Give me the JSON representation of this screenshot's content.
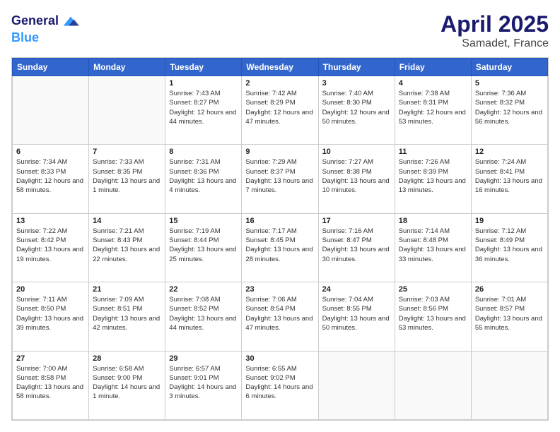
{
  "header": {
    "logo_line1": "General",
    "logo_line2": "Blue",
    "month": "April 2025",
    "location": "Samadet, France"
  },
  "days_of_week": [
    "Sunday",
    "Monday",
    "Tuesday",
    "Wednesday",
    "Thursday",
    "Friday",
    "Saturday"
  ],
  "weeks": [
    [
      {
        "day": "",
        "sunrise": "",
        "sunset": "",
        "daylight": ""
      },
      {
        "day": "",
        "sunrise": "",
        "sunset": "",
        "daylight": ""
      },
      {
        "day": "1",
        "sunrise": "Sunrise: 7:43 AM",
        "sunset": "Sunset: 8:27 PM",
        "daylight": "Daylight: 12 hours and 44 minutes."
      },
      {
        "day": "2",
        "sunrise": "Sunrise: 7:42 AM",
        "sunset": "Sunset: 8:29 PM",
        "daylight": "Daylight: 12 hours and 47 minutes."
      },
      {
        "day": "3",
        "sunrise": "Sunrise: 7:40 AM",
        "sunset": "Sunset: 8:30 PM",
        "daylight": "Daylight: 12 hours and 50 minutes."
      },
      {
        "day": "4",
        "sunrise": "Sunrise: 7:38 AM",
        "sunset": "Sunset: 8:31 PM",
        "daylight": "Daylight: 12 hours and 53 minutes."
      },
      {
        "day": "5",
        "sunrise": "Sunrise: 7:36 AM",
        "sunset": "Sunset: 8:32 PM",
        "daylight": "Daylight: 12 hours and 56 minutes."
      }
    ],
    [
      {
        "day": "6",
        "sunrise": "Sunrise: 7:34 AM",
        "sunset": "Sunset: 8:33 PM",
        "daylight": "Daylight: 12 hours and 58 minutes."
      },
      {
        "day": "7",
        "sunrise": "Sunrise: 7:33 AM",
        "sunset": "Sunset: 8:35 PM",
        "daylight": "Daylight: 13 hours and 1 minute."
      },
      {
        "day": "8",
        "sunrise": "Sunrise: 7:31 AM",
        "sunset": "Sunset: 8:36 PM",
        "daylight": "Daylight: 13 hours and 4 minutes."
      },
      {
        "day": "9",
        "sunrise": "Sunrise: 7:29 AM",
        "sunset": "Sunset: 8:37 PM",
        "daylight": "Daylight: 13 hours and 7 minutes."
      },
      {
        "day": "10",
        "sunrise": "Sunrise: 7:27 AM",
        "sunset": "Sunset: 8:38 PM",
        "daylight": "Daylight: 13 hours and 10 minutes."
      },
      {
        "day": "11",
        "sunrise": "Sunrise: 7:26 AM",
        "sunset": "Sunset: 8:39 PM",
        "daylight": "Daylight: 13 hours and 13 minutes."
      },
      {
        "day": "12",
        "sunrise": "Sunrise: 7:24 AM",
        "sunset": "Sunset: 8:41 PM",
        "daylight": "Daylight: 13 hours and 16 minutes."
      }
    ],
    [
      {
        "day": "13",
        "sunrise": "Sunrise: 7:22 AM",
        "sunset": "Sunset: 8:42 PM",
        "daylight": "Daylight: 13 hours and 19 minutes."
      },
      {
        "day": "14",
        "sunrise": "Sunrise: 7:21 AM",
        "sunset": "Sunset: 8:43 PM",
        "daylight": "Daylight: 13 hours and 22 minutes."
      },
      {
        "day": "15",
        "sunrise": "Sunrise: 7:19 AM",
        "sunset": "Sunset: 8:44 PM",
        "daylight": "Daylight: 13 hours and 25 minutes."
      },
      {
        "day": "16",
        "sunrise": "Sunrise: 7:17 AM",
        "sunset": "Sunset: 8:45 PM",
        "daylight": "Daylight: 13 hours and 28 minutes."
      },
      {
        "day": "17",
        "sunrise": "Sunrise: 7:16 AM",
        "sunset": "Sunset: 8:47 PM",
        "daylight": "Daylight: 13 hours and 30 minutes."
      },
      {
        "day": "18",
        "sunrise": "Sunrise: 7:14 AM",
        "sunset": "Sunset: 8:48 PM",
        "daylight": "Daylight: 13 hours and 33 minutes."
      },
      {
        "day": "19",
        "sunrise": "Sunrise: 7:12 AM",
        "sunset": "Sunset: 8:49 PM",
        "daylight": "Daylight: 13 hours and 36 minutes."
      }
    ],
    [
      {
        "day": "20",
        "sunrise": "Sunrise: 7:11 AM",
        "sunset": "Sunset: 8:50 PM",
        "daylight": "Daylight: 13 hours and 39 minutes."
      },
      {
        "day": "21",
        "sunrise": "Sunrise: 7:09 AM",
        "sunset": "Sunset: 8:51 PM",
        "daylight": "Daylight: 13 hours and 42 minutes."
      },
      {
        "day": "22",
        "sunrise": "Sunrise: 7:08 AM",
        "sunset": "Sunset: 8:52 PM",
        "daylight": "Daylight: 13 hours and 44 minutes."
      },
      {
        "day": "23",
        "sunrise": "Sunrise: 7:06 AM",
        "sunset": "Sunset: 8:54 PM",
        "daylight": "Daylight: 13 hours and 47 minutes."
      },
      {
        "day": "24",
        "sunrise": "Sunrise: 7:04 AM",
        "sunset": "Sunset: 8:55 PM",
        "daylight": "Daylight: 13 hours and 50 minutes."
      },
      {
        "day": "25",
        "sunrise": "Sunrise: 7:03 AM",
        "sunset": "Sunset: 8:56 PM",
        "daylight": "Daylight: 13 hours and 53 minutes."
      },
      {
        "day": "26",
        "sunrise": "Sunrise: 7:01 AM",
        "sunset": "Sunset: 8:57 PM",
        "daylight": "Daylight: 13 hours and 55 minutes."
      }
    ],
    [
      {
        "day": "27",
        "sunrise": "Sunrise: 7:00 AM",
        "sunset": "Sunset: 8:58 PM",
        "daylight": "Daylight: 13 hours and 58 minutes."
      },
      {
        "day": "28",
        "sunrise": "Sunrise: 6:58 AM",
        "sunset": "Sunset: 9:00 PM",
        "daylight": "Daylight: 14 hours and 1 minute."
      },
      {
        "day": "29",
        "sunrise": "Sunrise: 6:57 AM",
        "sunset": "Sunset: 9:01 PM",
        "daylight": "Daylight: 14 hours and 3 minutes."
      },
      {
        "day": "30",
        "sunrise": "Sunrise: 6:55 AM",
        "sunset": "Sunset: 9:02 PM",
        "daylight": "Daylight: 14 hours and 6 minutes."
      },
      {
        "day": "",
        "sunrise": "",
        "sunset": "",
        "daylight": ""
      },
      {
        "day": "",
        "sunrise": "",
        "sunset": "",
        "daylight": ""
      },
      {
        "day": "",
        "sunrise": "",
        "sunset": "",
        "daylight": ""
      }
    ]
  ]
}
